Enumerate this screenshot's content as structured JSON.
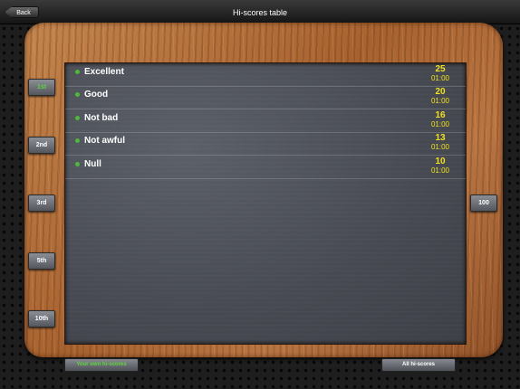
{
  "header": {
    "back_label": "Back",
    "title": "Hi-scores table"
  },
  "rank_buttons": [
    {
      "label": "1st",
      "active": true
    },
    {
      "label": "2nd"
    },
    {
      "label": "3rd"
    },
    {
      "label": "5th"
    },
    {
      "label": "10th"
    }
  ],
  "right_button": {
    "label": "100"
  },
  "scores": [
    {
      "label": "Excellent",
      "score": "25",
      "time": "01:00"
    },
    {
      "label": "Good",
      "score": "20",
      "time": "01:00"
    },
    {
      "label": "Not bad",
      "score": "16",
      "time": "01:00"
    },
    {
      "label": "Not awful",
      "score": "13",
      "time": "01:00"
    },
    {
      "label": "Null",
      "score": "10",
      "time": "01:00"
    }
  ],
  "bottom": {
    "own_label": "Your own hi-scores",
    "all_label": "All hi-scores"
  },
  "colors": {
    "active_green": "#5dd43a",
    "score_yellow": "#f0e020",
    "bullet_green": "#4db83a"
  }
}
